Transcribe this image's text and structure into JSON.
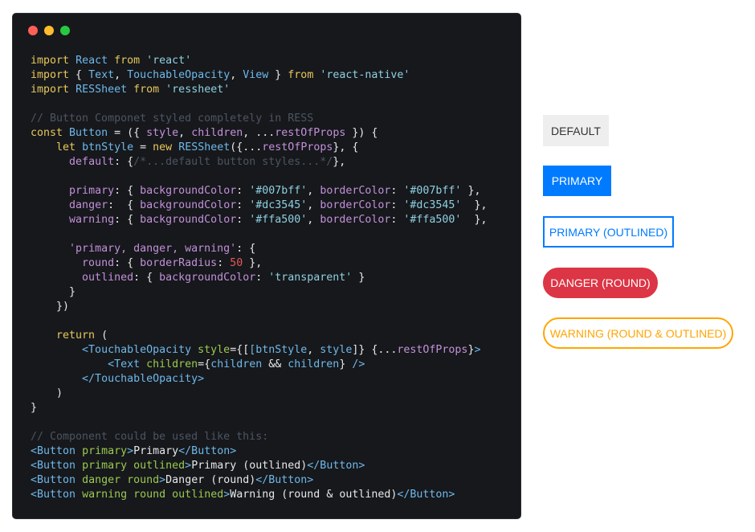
{
  "colors": {
    "editor_bg": "#16181c",
    "keyword": "#e8c85a",
    "identifier": "#6fb8e9",
    "property": "#c390d8",
    "string": "#8fd0e0",
    "number": "#e6595a",
    "comment": "#4d5561",
    "text": "#e8e8e8",
    "tag": "#6fb8e9",
    "attr": "#9cc94e",
    "primary": "#007bff",
    "danger": "#dc3545",
    "warning": "#ffa500",
    "default_bg": "#eeeeee"
  },
  "window_dots": [
    {
      "name": "close-dot",
      "color": "#ff5f57"
    },
    {
      "name": "minimize-dot",
      "color": "#febc2e"
    },
    {
      "name": "maximize-dot",
      "color": "#28c840"
    }
  ],
  "code_lines": [
    [
      [
        "k",
        "import"
      ],
      [
        "t",
        " "
      ],
      [
        "i",
        "React"
      ],
      [
        "t",
        " "
      ],
      [
        "k",
        "from"
      ],
      [
        "t",
        " "
      ],
      [
        "s",
        "'react'"
      ]
    ],
    [
      [
        "k",
        "import"
      ],
      [
        "t",
        " { "
      ],
      [
        "i",
        "Text"
      ],
      [
        "t",
        ", "
      ],
      [
        "i",
        "TouchableOpacity"
      ],
      [
        "t",
        ", "
      ],
      [
        "i",
        "View"
      ],
      [
        "t",
        " } "
      ],
      [
        "k",
        "from"
      ],
      [
        "t",
        " "
      ],
      [
        "s",
        "'react-native'"
      ]
    ],
    [
      [
        "k",
        "import"
      ],
      [
        "t",
        " "
      ],
      [
        "i",
        "RESSheet"
      ],
      [
        "t",
        " "
      ],
      [
        "k",
        "from"
      ],
      [
        "t",
        " "
      ],
      [
        "s",
        "'ressheet'"
      ]
    ],
    [],
    [
      [
        "c",
        "// Button Componet styled completely in RESS"
      ]
    ],
    [
      [
        "k",
        "const"
      ],
      [
        "t",
        " "
      ],
      [
        "i",
        "Button"
      ],
      [
        "t",
        " = ({ "
      ],
      [
        "p",
        "style"
      ],
      [
        "t",
        ", "
      ],
      [
        "p",
        "children"
      ],
      [
        "t",
        ", ..."
      ],
      [
        "p",
        "restOfProps"
      ],
      [
        "t",
        " }) {"
      ]
    ],
    [
      [
        "t",
        "    "
      ],
      [
        "k",
        "let"
      ],
      [
        "t",
        " "
      ],
      [
        "i",
        "btnStyle"
      ],
      [
        "t",
        " = "
      ],
      [
        "k",
        "new"
      ],
      [
        "t",
        " "
      ],
      [
        "i",
        "RESSheet"
      ],
      [
        "t",
        "({..."
      ],
      [
        "p",
        "restOfProps"
      ],
      [
        "t",
        "}, {"
      ]
    ],
    [
      [
        "t",
        "      "
      ],
      [
        "p",
        "default"
      ],
      [
        "t",
        ": {"
      ],
      [
        "c",
        "/*...default button styles...*/"
      ],
      [
        "t",
        "},"
      ]
    ],
    [],
    [
      [
        "t",
        "      "
      ],
      [
        "p",
        "primary"
      ],
      [
        "t",
        ": { "
      ],
      [
        "p",
        "backgroundColor"
      ],
      [
        "t",
        ": "
      ],
      [
        "s",
        "'#007bff'"
      ],
      [
        "t",
        ", "
      ],
      [
        "p",
        "borderColor"
      ],
      [
        "t",
        ": "
      ],
      [
        "s",
        "'#007bff'"
      ],
      [
        "t",
        " },"
      ]
    ],
    [
      [
        "t",
        "      "
      ],
      [
        "p",
        "danger"
      ],
      [
        "t",
        ":  { "
      ],
      [
        "p",
        "backgroundColor"
      ],
      [
        "t",
        ": "
      ],
      [
        "s",
        "'#dc3545'"
      ],
      [
        "t",
        ", "
      ],
      [
        "p",
        "borderColor"
      ],
      [
        "t",
        ": "
      ],
      [
        "s",
        "'#dc3545'"
      ],
      [
        "t",
        "  },"
      ]
    ],
    [
      [
        "t",
        "      "
      ],
      [
        "p",
        "warning"
      ],
      [
        "t",
        ": { "
      ],
      [
        "p",
        "backgroundColor"
      ],
      [
        "t",
        ": "
      ],
      [
        "s",
        "'#ffa500'"
      ],
      [
        "t",
        ", "
      ],
      [
        "p",
        "borderColor"
      ],
      [
        "t",
        ": "
      ],
      [
        "s",
        "'#ffa500'"
      ],
      [
        "t",
        "  },"
      ]
    ],
    [],
    [
      [
        "t",
        "      "
      ],
      [
        "p",
        "'primary, danger, warning'"
      ],
      [
        "t",
        ": {"
      ]
    ],
    [
      [
        "t",
        "        "
      ],
      [
        "p",
        "round"
      ],
      [
        "t",
        ": { "
      ],
      [
        "p",
        "borderRadius"
      ],
      [
        "t",
        ": "
      ],
      [
        "n",
        "50"
      ],
      [
        "t",
        " },"
      ]
    ],
    [
      [
        "t",
        "        "
      ],
      [
        "p",
        "outlined"
      ],
      [
        "t",
        ": { "
      ],
      [
        "p",
        "backgroundColor"
      ],
      [
        "t",
        ": "
      ],
      [
        "s",
        "'transparent'"
      ],
      [
        "t",
        " }"
      ]
    ],
    [
      [
        "t",
        "      }"
      ]
    ],
    [
      [
        "t",
        "    })"
      ]
    ],
    [],
    [
      [
        "t",
        "    "
      ],
      [
        "k",
        "return"
      ],
      [
        "t",
        " ("
      ]
    ],
    [
      [
        "t",
        "        "
      ],
      [
        "g",
        "<TouchableOpacity"
      ],
      [
        "t",
        " "
      ],
      [
        "a",
        "style"
      ],
      [
        "t",
        "={["
      ],
      [
        "i",
        "[btnStyle"
      ],
      [
        "t",
        ", "
      ],
      [
        "i",
        "style"
      ],
      [
        "t",
        "]} {..."
      ],
      [
        "p",
        "restOfProps"
      ],
      [
        "t",
        "}"
      ],
      [
        "g",
        ">"
      ]
    ],
    [
      [
        "t",
        "            "
      ],
      [
        "g",
        "<Text"
      ],
      [
        "t",
        " "
      ],
      [
        "a",
        "children"
      ],
      [
        "t",
        "={"
      ],
      [
        "i",
        "children"
      ],
      [
        "t",
        " && "
      ],
      [
        "i",
        "children"
      ],
      [
        "t",
        "} "
      ],
      [
        "g",
        "/>"
      ]
    ],
    [
      [
        "t",
        "        "
      ],
      [
        "g",
        "</TouchableOpacity>"
      ]
    ],
    [
      [
        "t",
        "    )"
      ]
    ],
    [
      [
        "t",
        "}"
      ]
    ],
    [],
    [
      [
        "c",
        "// Component could be used like this:"
      ]
    ],
    [
      [
        "g",
        "<Button"
      ],
      [
        "t",
        " "
      ],
      [
        "a",
        "primary"
      ],
      [
        "g",
        ">"
      ],
      [
        "t",
        "Primary"
      ],
      [
        "g",
        "</Button>"
      ]
    ],
    [
      [
        "g",
        "<Button"
      ],
      [
        "t",
        " "
      ],
      [
        "a",
        "primary"
      ],
      [
        "t",
        " "
      ],
      [
        "a",
        "outlined"
      ],
      [
        "g",
        ">"
      ],
      [
        "t",
        "Primary (outlined)"
      ],
      [
        "g",
        "</Button>"
      ]
    ],
    [
      [
        "g",
        "<Button"
      ],
      [
        "t",
        " "
      ],
      [
        "a",
        "danger"
      ],
      [
        "t",
        " "
      ],
      [
        "a",
        "round"
      ],
      [
        "g",
        ">"
      ],
      [
        "t",
        "Danger (round)"
      ],
      [
        "g",
        "</Button>"
      ]
    ],
    [
      [
        "g",
        "<Button"
      ],
      [
        "t",
        " "
      ],
      [
        "a",
        "warning"
      ],
      [
        "t",
        " "
      ],
      [
        "a",
        "round"
      ],
      [
        "t",
        " "
      ],
      [
        "a",
        "outlined"
      ],
      [
        "g",
        ">"
      ],
      [
        "t",
        "Warning (round & outlined)"
      ],
      [
        "g",
        "</Button>"
      ]
    ]
  ],
  "buttons": {
    "default": "DEFAULT",
    "primary": "PRIMARY",
    "primary_outlined": "PRIMARY (OUTLINED)",
    "danger_round": "DANGER (ROUND)",
    "warning_round_outlined": "WARNING (ROUND & OUTLINED)"
  }
}
